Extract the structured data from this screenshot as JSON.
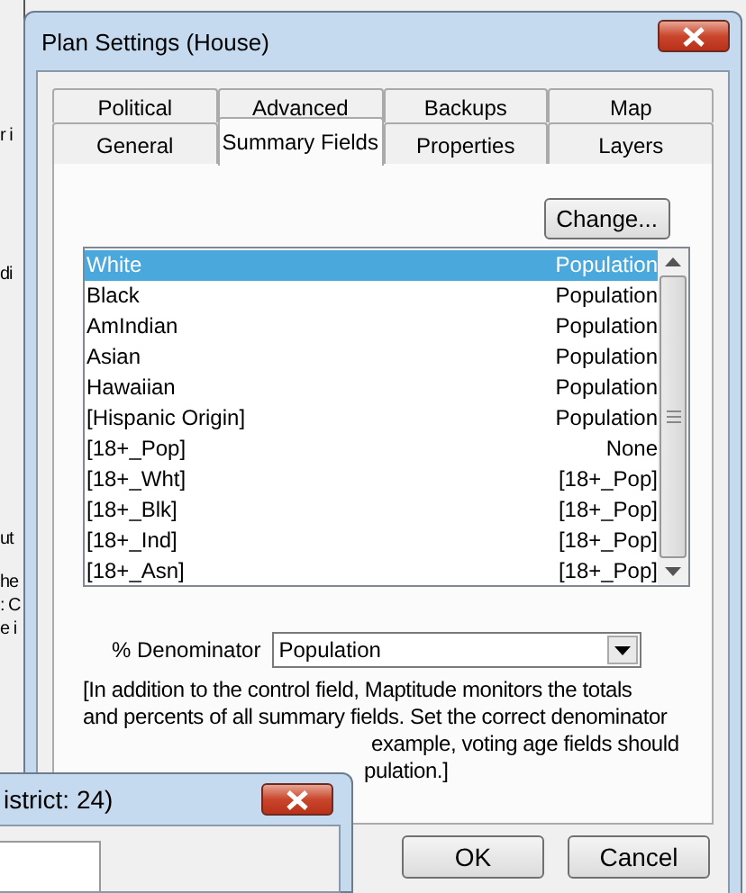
{
  "background_window": {
    "fragments": [
      "r i",
      "di",
      "ut",
      "he",
      ": C",
      "e i"
    ]
  },
  "window": {
    "title": "Plan Settings (House)"
  },
  "tab_rows": [
    [
      {
        "label": "Political",
        "selected": false
      },
      {
        "label": "Advanced",
        "selected": false
      },
      {
        "label": "Backups",
        "selected": false
      },
      {
        "label": "Map",
        "selected": false
      }
    ],
    [
      {
        "label": "General",
        "selected": false
      },
      {
        "label": "Summary Fields",
        "selected": true
      },
      {
        "label": "Properties",
        "selected": false
      },
      {
        "label": "Layers",
        "selected": false
      }
    ]
  ],
  "change_button": "Change...",
  "summary_fields": [
    {
      "name": "White",
      "denominator": "Population",
      "selected": true
    },
    {
      "name": "Black",
      "denominator": "Population",
      "selected": false
    },
    {
      "name": "AmIndian",
      "denominator": "Population",
      "selected": false
    },
    {
      "name": "Asian",
      "denominator": "Population",
      "selected": false
    },
    {
      "name": "Hawaiian",
      "denominator": "Population",
      "selected": false
    },
    {
      "name": "[Hispanic Origin]",
      "denominator": "Population",
      "selected": false
    },
    {
      "name": "[18+_Pop]",
      "denominator": "None",
      "selected": false
    },
    {
      "name": "[18+_Wht]",
      "denominator": "[18+_Pop]",
      "selected": false
    },
    {
      "name": "[18+_Blk]",
      "denominator": "[18+_Pop]",
      "selected": false
    },
    {
      "name": "[18+_Ind]",
      "denominator": "[18+_Pop]",
      "selected": false
    },
    {
      "name": "[18+_Asn]",
      "denominator": "[18+_Pop]",
      "selected": false
    }
  ],
  "denominator": {
    "label": "% Denominator",
    "value": "Population"
  },
  "description_lines": [
    "[In addition to the control field, Maptitude monitors the totals",
    "and percents of all summary fields. Set the correct denominator",
    "example, voting age fields should",
    "pulation.]"
  ],
  "buttons": [
    "OK",
    "Cancel"
  ],
  "front_window": {
    "title": "istrict: 24)"
  }
}
